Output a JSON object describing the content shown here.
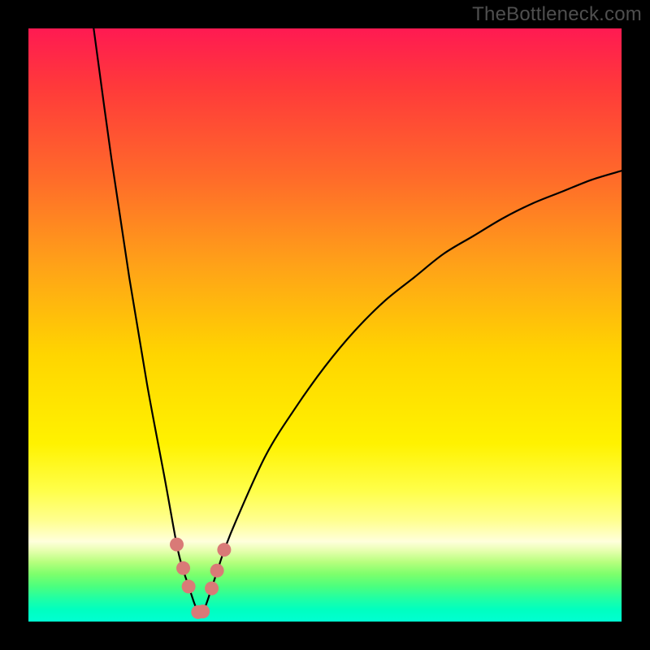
{
  "watermark": "TheBottleneck.com",
  "colors": {
    "page_bg": "#000000",
    "watermark_text": "#4f4f4f",
    "curve_stroke": "#000000",
    "marker_fill": "#d97a77",
    "marker_stroke": "#d97a77",
    "gradient_top": "#ff1a52",
    "gradient_bottom": "#00ffd2"
  },
  "chart_data": {
    "type": "line",
    "title": "",
    "xlabel": "",
    "ylabel": "",
    "xlim": [
      0,
      100
    ],
    "ylim": [
      0,
      100
    ],
    "grid": false,
    "legend": false,
    "notes": "V-shaped bottleneck curve on rainbow gradient. Y≈100 at x≈11, drops to ≈0 near x≈29, rises toward ≈76 at x=100. Axes unlabeled.",
    "series": [
      {
        "name": "curve",
        "x": [
          11.0,
          14,
          17,
          20,
          23,
          25,
          26,
          27,
          28,
          28.7,
          29.3,
          30,
          31,
          32,
          33,
          35,
          40,
          45,
          50,
          55,
          60,
          65,
          70,
          75,
          80,
          85,
          90,
          95,
          100
        ],
        "values": [
          100,
          78,
          58,
          40,
          24,
          13,
          9,
          6,
          3,
          1.5,
          1.5,
          3,
          6,
          9,
          12,
          17,
          28,
          36,
          43,
          49,
          54,
          58,
          62,
          65,
          68,
          70.5,
          72.5,
          74.5,
          76
        ]
      }
    ],
    "markers": {
      "name": "highlight-points",
      "x": [
        25.0,
        26.1,
        27.0,
        28.6,
        29.4,
        30.9,
        31.8,
        33.0
      ],
      "values": [
        13.0,
        9.0,
        5.9,
        1.6,
        1.7,
        5.6,
        8.6,
        12.1
      ]
    }
  }
}
